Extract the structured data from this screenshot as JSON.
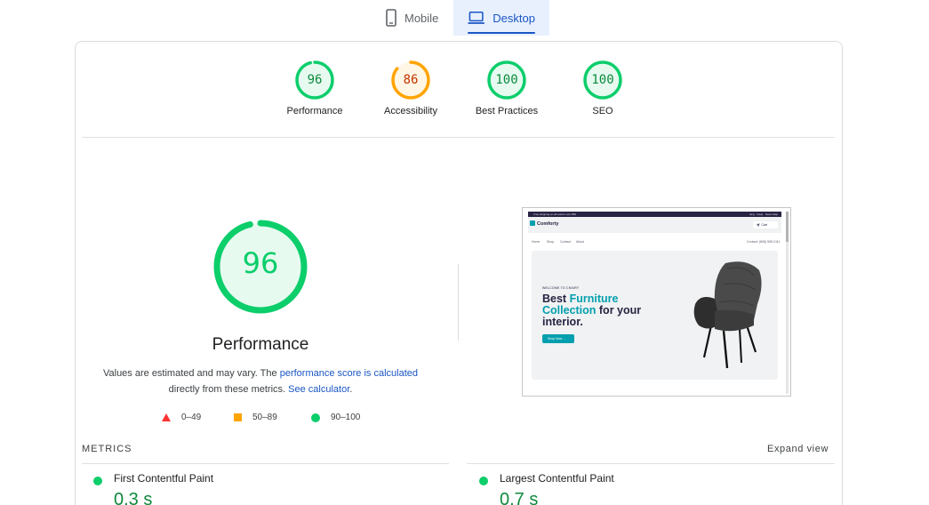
{
  "device_tabs": {
    "mobile_label": "Mobile",
    "desktop_label": "Desktop",
    "selected": "desktop"
  },
  "categories": [
    {
      "label": "Performance",
      "score": "96",
      "value": 96,
      "color": "#0cce6b",
      "text_color": "#0d8a3c"
    },
    {
      "label": "Accessibility",
      "score": "86",
      "value": 86,
      "color": "#ffa400",
      "text_color": "#c33300"
    },
    {
      "label": "Best Practices",
      "score": "100",
      "value": 100,
      "color": "#0cce6b",
      "text_color": "#0d8a3c"
    },
    {
      "label": "SEO",
      "score": "100",
      "value": 100,
      "color": "#0cce6b",
      "text_color": "#0d8a3c"
    }
  ],
  "performance": {
    "score": "96",
    "value": 96,
    "title": "Performance",
    "note_text1": "Values are estimated and may vary. The ",
    "note_link1": "performance score is calculated",
    "note_text2": "directly from these metrics. ",
    "note_link2": "See calculator",
    "note_text3": "."
  },
  "legend": [
    {
      "shape": "triangle",
      "range": "0–49",
      "color": "#ff3333"
    },
    {
      "shape": "square",
      "range": "50–89",
      "color": "#ffa400"
    },
    {
      "shape": "circle",
      "range": "90–100",
      "color": "#0cce6b"
    }
  ],
  "preview": {
    "topbar_left": "Free shipping on all orders over $50",
    "topbar_right": "Eng · Faqs · Need Help",
    "logo": "Comforty",
    "cart_label": "Cart",
    "nav": [
      "Home",
      "Shop",
      "Contact",
      "About"
    ],
    "contact": "Contact: (808) 555-0111",
    "hero_welcome": "WELCOME TO CHAIRY",
    "hero_title_1": "Best ",
    "hero_title_accent_1": "Furniture",
    "hero_title_accent_2": "Collection",
    "hero_title_2": " for your",
    "hero_title_3": "interior.",
    "hero_button": "Shop Now →"
  },
  "metrics": {
    "heading": "METRICS",
    "expand_label": "Expand view",
    "items": [
      {
        "name": "First Contentful Paint",
        "value": "0.3 s",
        "status_color": "#0cce6b"
      },
      {
        "name": "Largest Contentful Paint",
        "value": "0.7 s",
        "status_color": "#0cce6b"
      }
    ]
  }
}
